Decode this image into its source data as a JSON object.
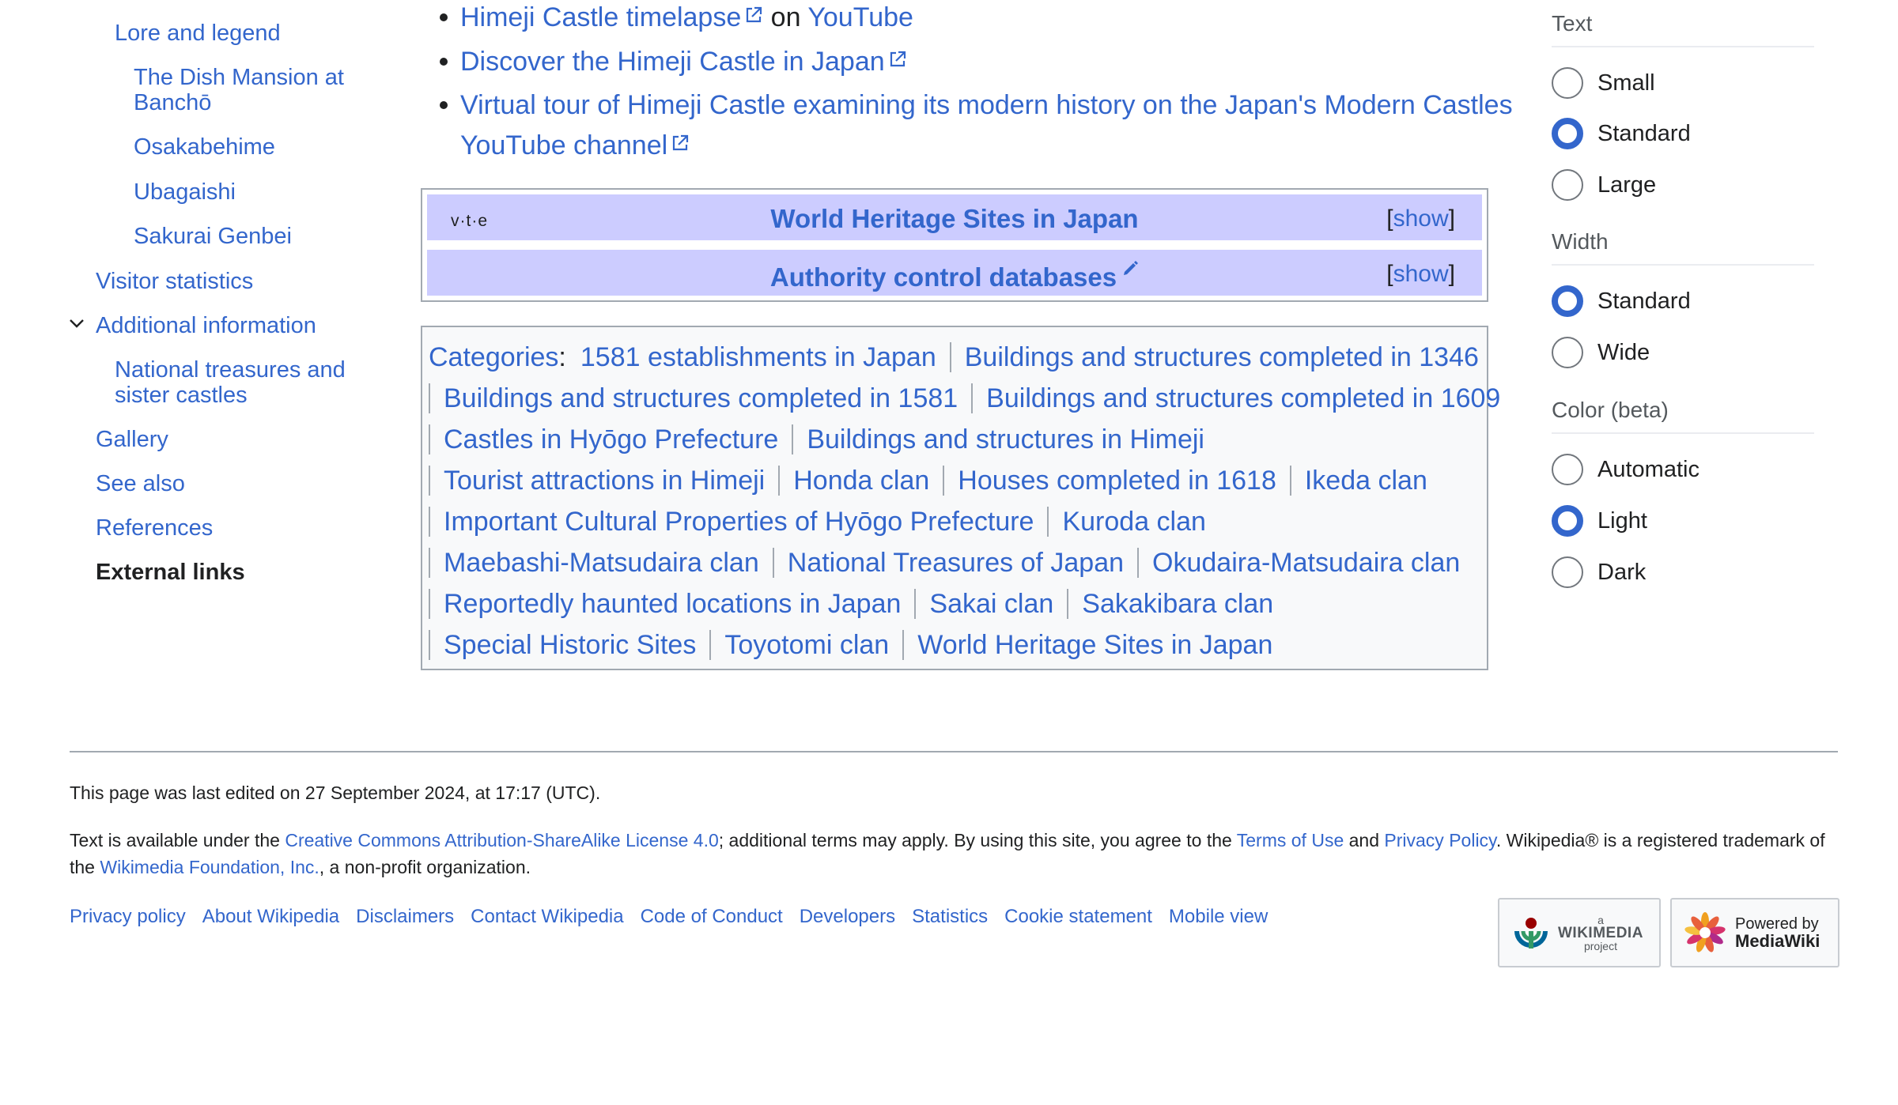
{
  "toc": {
    "items": [
      {
        "label": "Lore and legend"
      },
      {
        "label": "The Dish Mansion at\nBanchō"
      },
      {
        "label": "Osakabehime"
      },
      {
        "label": "Ubagaishi"
      },
      {
        "label": "Sakurai Genbei"
      },
      {
        "label": "Visitor statistics"
      },
      {
        "label": "Additional information"
      },
      {
        "label": "National treasures and\nsister castles"
      },
      {
        "label": "Gallery"
      },
      {
        "label": "See also"
      },
      {
        "label": "References"
      },
      {
        "label": "External links"
      }
    ]
  },
  "external_links": [
    {
      "link": "Himeji Castle timelapse",
      "suffix": " on ",
      "link2": "YouTube"
    },
    {
      "link": "Discover the Himeji Castle in Japan"
    },
    {
      "link_line1": "Virtual tour of Himeji Castle examining its modern history on the Japan's Modern Castles",
      "link_line2": "YouTube channel"
    }
  ],
  "navbox": {
    "vte": {
      "v": "v",
      "t": "t",
      "e": "e",
      "sep": "·"
    },
    "title1": "World Heritage Sites in Japan",
    "title2": "Authority control databases",
    "show": "show",
    "bracket_open": "[",
    "bracket_close": "]"
  },
  "categories": {
    "label": "Categories",
    "colon": ":",
    "lines": [
      [
        "1581 establishments in Japan",
        "Buildings and structures completed in 1346"
      ],
      [
        "Buildings and structures completed in 1581",
        "Buildings and structures completed in 1609"
      ],
      [
        "Castles in Hyōgo Prefecture",
        "Buildings and structures in Himeji"
      ],
      [
        "Tourist attractions in Himeji",
        "Honda clan",
        "Houses completed in 1618",
        "Ikeda clan"
      ],
      [
        "Important Cultural Properties of Hyōgo Prefecture",
        "Kuroda clan"
      ],
      [
        "Maebashi-Matsudaira clan",
        "National Treasures of Japan",
        "Okudaira-Matsudaira clan"
      ],
      [
        "Reportedly haunted locations in Japan",
        "Sakai clan",
        "Sakakibara clan"
      ],
      [
        "Special Historic Sites",
        "Toyotomi clan",
        "World Heritage Sites in Japan"
      ]
    ]
  },
  "appearance": {
    "text_heading": "Text",
    "text_options": [
      {
        "label": "Small",
        "checked": false
      },
      {
        "label": "Standard",
        "checked": true
      },
      {
        "label": "Large",
        "checked": false
      }
    ],
    "width_heading": "Width",
    "width_options": [
      {
        "label": "Standard",
        "checked": true
      },
      {
        "label": "Wide",
        "checked": false
      }
    ],
    "color_heading": "Color (beta)",
    "color_options": [
      {
        "label": "Automatic",
        "checked": false
      },
      {
        "label": "Light",
        "checked": true
      },
      {
        "label": "Dark",
        "checked": false
      }
    ],
    "accent_color": "#3366cc"
  },
  "footer": {
    "last_edited": "This page was last edited on 27 September 2024, at 17:17 (UTC).",
    "license": {
      "t1": "Text is available under the ",
      "l1": "Creative Commons Attribution-ShareAlike License 4.0",
      "t2": "; additional terms may apply. By using this site, you agree to the ",
      "l2": "Terms of Use",
      "t3": " and ",
      "l3": "Privacy Policy",
      "t4": ". Wikipedia® is a registered trademark of the ",
      "l4": "Wikimedia Foundation, Inc.",
      "t5": ", a non-profit organization."
    },
    "links": [
      "Privacy policy",
      "About Wikipedia",
      "Disclaimers",
      "Contact Wikipedia",
      "Code of Conduct",
      "Developers",
      "Statistics",
      "Cookie statement",
      "Mobile view"
    ],
    "wikimedia_badge": {
      "small": "a",
      "big": "WIKIMEDIA",
      "small2": "project"
    },
    "mediawiki_badge": {
      "line1": "Powered by",
      "line2": "MediaWiki"
    }
  }
}
